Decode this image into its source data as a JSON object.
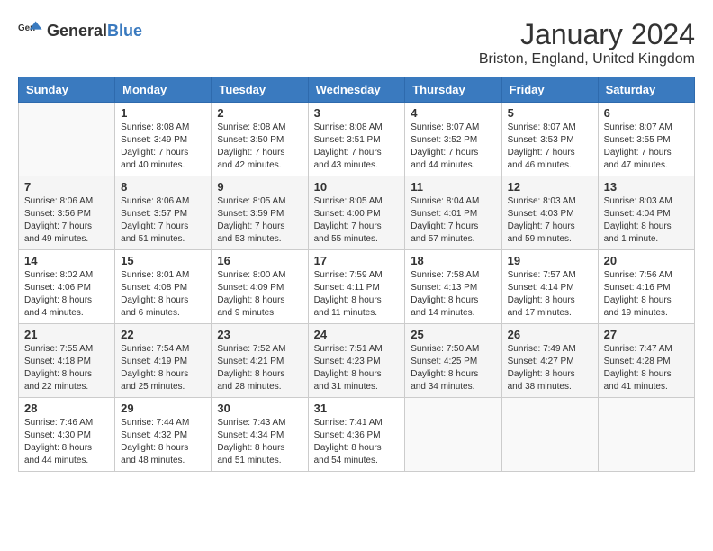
{
  "header": {
    "logo_general": "General",
    "logo_blue": "Blue",
    "month": "January 2024",
    "location": "Briston, England, United Kingdom"
  },
  "weekdays": [
    "Sunday",
    "Monday",
    "Tuesday",
    "Wednesday",
    "Thursday",
    "Friday",
    "Saturday"
  ],
  "weeks": [
    [
      {
        "day": "",
        "info": ""
      },
      {
        "day": "1",
        "info": "Sunrise: 8:08 AM\nSunset: 3:49 PM\nDaylight: 7 hours\nand 40 minutes."
      },
      {
        "day": "2",
        "info": "Sunrise: 8:08 AM\nSunset: 3:50 PM\nDaylight: 7 hours\nand 42 minutes."
      },
      {
        "day": "3",
        "info": "Sunrise: 8:08 AM\nSunset: 3:51 PM\nDaylight: 7 hours\nand 43 minutes."
      },
      {
        "day": "4",
        "info": "Sunrise: 8:07 AM\nSunset: 3:52 PM\nDaylight: 7 hours\nand 44 minutes."
      },
      {
        "day": "5",
        "info": "Sunrise: 8:07 AM\nSunset: 3:53 PM\nDaylight: 7 hours\nand 46 minutes."
      },
      {
        "day": "6",
        "info": "Sunrise: 8:07 AM\nSunset: 3:55 PM\nDaylight: 7 hours\nand 47 minutes."
      }
    ],
    [
      {
        "day": "7",
        "info": "Sunrise: 8:06 AM\nSunset: 3:56 PM\nDaylight: 7 hours\nand 49 minutes."
      },
      {
        "day": "8",
        "info": "Sunrise: 8:06 AM\nSunset: 3:57 PM\nDaylight: 7 hours\nand 51 minutes."
      },
      {
        "day": "9",
        "info": "Sunrise: 8:05 AM\nSunset: 3:59 PM\nDaylight: 7 hours\nand 53 minutes."
      },
      {
        "day": "10",
        "info": "Sunrise: 8:05 AM\nSunset: 4:00 PM\nDaylight: 7 hours\nand 55 minutes."
      },
      {
        "day": "11",
        "info": "Sunrise: 8:04 AM\nSunset: 4:01 PM\nDaylight: 7 hours\nand 57 minutes."
      },
      {
        "day": "12",
        "info": "Sunrise: 8:03 AM\nSunset: 4:03 PM\nDaylight: 7 hours\nand 59 minutes."
      },
      {
        "day": "13",
        "info": "Sunrise: 8:03 AM\nSunset: 4:04 PM\nDaylight: 8 hours\nand 1 minute."
      }
    ],
    [
      {
        "day": "14",
        "info": "Sunrise: 8:02 AM\nSunset: 4:06 PM\nDaylight: 8 hours\nand 4 minutes."
      },
      {
        "day": "15",
        "info": "Sunrise: 8:01 AM\nSunset: 4:08 PM\nDaylight: 8 hours\nand 6 minutes."
      },
      {
        "day": "16",
        "info": "Sunrise: 8:00 AM\nSunset: 4:09 PM\nDaylight: 8 hours\nand 9 minutes."
      },
      {
        "day": "17",
        "info": "Sunrise: 7:59 AM\nSunset: 4:11 PM\nDaylight: 8 hours\nand 11 minutes."
      },
      {
        "day": "18",
        "info": "Sunrise: 7:58 AM\nSunset: 4:13 PM\nDaylight: 8 hours\nand 14 minutes."
      },
      {
        "day": "19",
        "info": "Sunrise: 7:57 AM\nSunset: 4:14 PM\nDaylight: 8 hours\nand 17 minutes."
      },
      {
        "day": "20",
        "info": "Sunrise: 7:56 AM\nSunset: 4:16 PM\nDaylight: 8 hours\nand 19 minutes."
      }
    ],
    [
      {
        "day": "21",
        "info": "Sunrise: 7:55 AM\nSunset: 4:18 PM\nDaylight: 8 hours\nand 22 minutes."
      },
      {
        "day": "22",
        "info": "Sunrise: 7:54 AM\nSunset: 4:19 PM\nDaylight: 8 hours\nand 25 minutes."
      },
      {
        "day": "23",
        "info": "Sunrise: 7:52 AM\nSunset: 4:21 PM\nDaylight: 8 hours\nand 28 minutes."
      },
      {
        "day": "24",
        "info": "Sunrise: 7:51 AM\nSunset: 4:23 PM\nDaylight: 8 hours\nand 31 minutes."
      },
      {
        "day": "25",
        "info": "Sunrise: 7:50 AM\nSunset: 4:25 PM\nDaylight: 8 hours\nand 34 minutes."
      },
      {
        "day": "26",
        "info": "Sunrise: 7:49 AM\nSunset: 4:27 PM\nDaylight: 8 hours\nand 38 minutes."
      },
      {
        "day": "27",
        "info": "Sunrise: 7:47 AM\nSunset: 4:28 PM\nDaylight: 8 hours\nand 41 minutes."
      }
    ],
    [
      {
        "day": "28",
        "info": "Sunrise: 7:46 AM\nSunset: 4:30 PM\nDaylight: 8 hours\nand 44 minutes."
      },
      {
        "day": "29",
        "info": "Sunrise: 7:44 AM\nSunset: 4:32 PM\nDaylight: 8 hours\nand 48 minutes."
      },
      {
        "day": "30",
        "info": "Sunrise: 7:43 AM\nSunset: 4:34 PM\nDaylight: 8 hours\nand 51 minutes."
      },
      {
        "day": "31",
        "info": "Sunrise: 7:41 AM\nSunset: 4:36 PM\nDaylight: 8 hours\nand 54 minutes."
      },
      {
        "day": "",
        "info": ""
      },
      {
        "day": "",
        "info": ""
      },
      {
        "day": "",
        "info": ""
      }
    ]
  ]
}
